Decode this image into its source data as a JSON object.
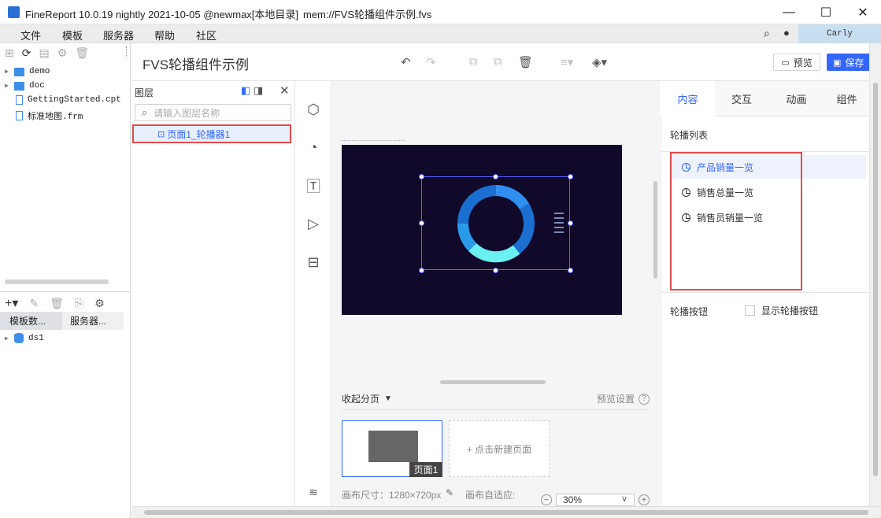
{
  "window": {
    "title": "FineReport 10.0.19 nightly 2021-10-05 @newmax[本地目录]",
    "path": "mem://FVS轮播组件示例.fvs",
    "min": "—",
    "max": "☐",
    "close": "✕"
  },
  "menu": [
    "文件",
    "模板",
    "服务器",
    "帮助",
    "社区"
  ],
  "user": "Carly",
  "file_tree": {
    "items": [
      {
        "name": "demo",
        "type": "folder"
      },
      {
        "name": "doc",
        "type": "folder"
      },
      {
        "name": "GettingStarted.cpt",
        "type": "file"
      },
      {
        "name": "标准地图.frm",
        "type": "file"
      }
    ]
  },
  "bottom_left": {
    "tabs": [
      "模板数...",
      "服务器..."
    ],
    "datasource": "ds1"
  },
  "editor": {
    "doc_title": "FVS轮播组件示例",
    "preview_label": "预览",
    "save_label": "保存"
  },
  "layers": {
    "title": "图层",
    "search_placeholder": "请输入图层名称",
    "item": "页面1_轮播器1"
  },
  "pages": {
    "collapse_label": "收起分页",
    "preview_settings": "预览设置",
    "page_label": "页面1",
    "new_page": "+ 点击新建页面",
    "canvas_size": "画布尺寸：1280×720px",
    "canvas_fit": "画布自适应:",
    "zoom": "30%"
  },
  "right_panel": {
    "tabs": [
      "内容",
      "交互",
      "动画",
      "组件"
    ],
    "list_title": "轮播列表",
    "list_items": [
      "产品销量一览",
      "销售总量一览",
      "销售员销量一览"
    ],
    "button_label": "轮播按钮",
    "show_button_label": "显示轮播按钮"
  },
  "colors": {
    "accent": "#3366ff",
    "canvas_bg": "#10092a",
    "highlight_red": "#e64a4a"
  }
}
